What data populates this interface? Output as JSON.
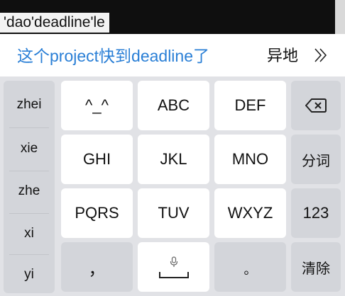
{
  "composing": {
    "text": "'dao'deadline'le"
  },
  "candidates": {
    "primary": "这个project快到deadline了",
    "next": "异地",
    "expand_glyph": "》"
  },
  "pinyin_list": [
    "zhei",
    "xie",
    "zhe",
    "xi",
    "yi"
  ],
  "keys": {
    "emoticon": "^_^",
    "abc": "ABC",
    "def": "DEF",
    "ghi": "GHI",
    "jkl": "JKL",
    "mno": "MNO",
    "segment": "分词",
    "pqrs": "PQRS",
    "tuv": "TUV",
    "wxyz": "WXYZ",
    "num": "123",
    "comma": "，",
    "period": "。",
    "clear": "清除"
  },
  "colors": {
    "candidate_blue": "#2a7fd6",
    "key_light": "#ffffff",
    "key_dark": "#d3d5da",
    "keyboard_bg": "#e1e2e6"
  }
}
